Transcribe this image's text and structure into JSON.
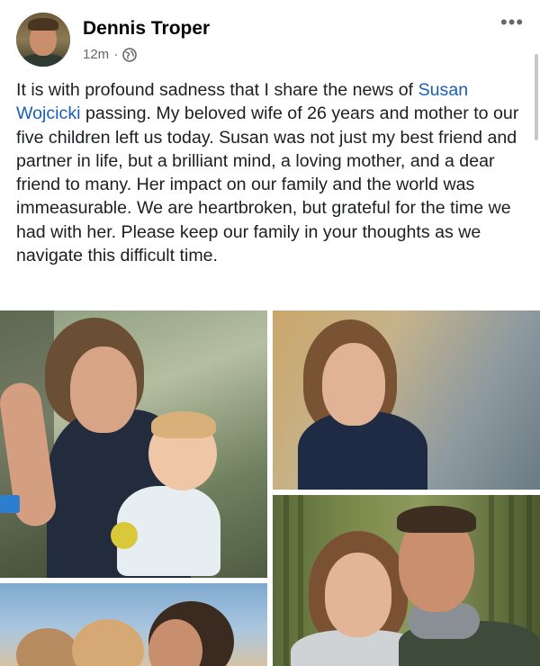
{
  "post": {
    "author": "Dennis Troper",
    "time": "12m",
    "separator": "·",
    "audience_icon": "globe-icon",
    "more_label": "•••",
    "text_before_mention": "It is with profound sadness that I share the news of ",
    "mention": "Susan Wojcicki",
    "text_after_mention": " passing. My beloved wife of 26 years and mother to our five children left us today. Susan was not just my best friend and partner in life, but a brilliant mind, a loving mother, and a dear friend to many. Her impact on our family and the world was immeasurable. We are heartbroken, but grateful for the time we had with her. Please keep our family in your thoughts as we navigate this difficult time."
  },
  "colors": {
    "mention": "#1a5fb4",
    "meta_gray": "#65676b",
    "text": "#1c1e21"
  }
}
